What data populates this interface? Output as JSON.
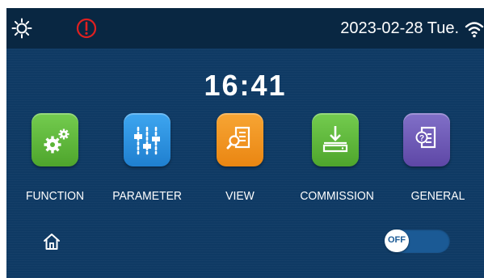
{
  "status_bar": {
    "date": "2023-02-28 Tue.",
    "icons": [
      "sun-icon",
      "alarm-icon",
      "wifi-icon"
    ]
  },
  "clock": {
    "time": "16:41"
  },
  "menu": {
    "items": [
      {
        "label": "FUNCTION",
        "icon": "gears-icon",
        "color": "#5bb536"
      },
      {
        "label": "PARAMETER",
        "icon": "sliders-icon",
        "color": "#2a8fdc"
      },
      {
        "label": "VIEW",
        "icon": "document-search-icon",
        "color": "#f0901c"
      },
      {
        "label": "COMMISSION",
        "icon": "download-icon",
        "color": "#5bb536"
      },
      {
        "label": "GENERAL",
        "icon": "document-help-icon",
        "color": "#7059b6"
      }
    ]
  },
  "footer": {
    "home_icon": "home-icon",
    "toggle_label": "OFF",
    "toggle_state": "off"
  },
  "colors": {
    "background": "#0f3a64",
    "status_bar": "#092742",
    "alarm": "#e02020"
  }
}
